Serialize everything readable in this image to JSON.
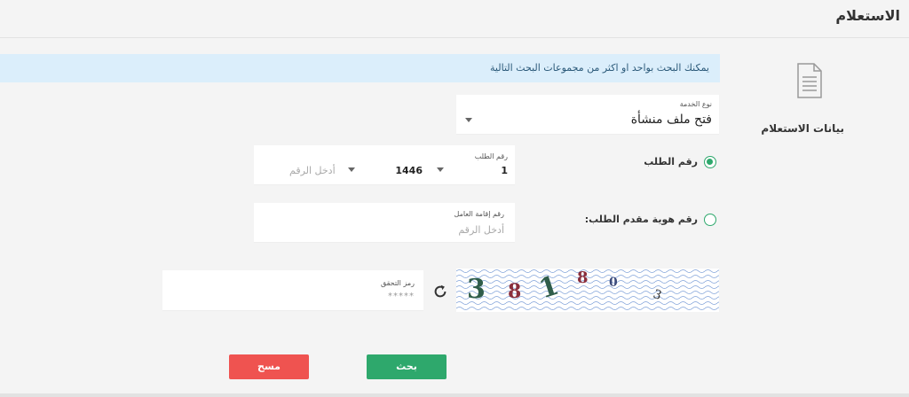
{
  "header": {
    "title": "الاستعلام"
  },
  "info": {
    "text": "يمكنك البحث بواحد او اكثر من مجموعات البحث التالية"
  },
  "sidebar": {
    "title": "بيانات الاستعلام",
    "icon": "document-icon"
  },
  "service": {
    "label": "نوع الخدمة",
    "value": "فتح ملف منشأة"
  },
  "search_by_request": {
    "label": "رقم الطلب",
    "selected": true,
    "field_label": "رقم الطلب",
    "number_value": "1",
    "year_value": "1446",
    "number_placeholder": "أدخل الرقم"
  },
  "search_by_id": {
    "label": "رقم هوية مقدم الطلب:",
    "selected": false,
    "field_label": "رقم إقامة العامل",
    "placeholder": "أدخل الرقم"
  },
  "captcha": {
    "field_label": "رمز التحقق",
    "placeholder": "*****",
    "chars": [
      "3",
      "8",
      "1",
      "8",
      "0",
      "3"
    ],
    "refresh_icon": "refresh-icon"
  },
  "buttons": {
    "search": "بحث",
    "clear": "مسح"
  },
  "colors": {
    "accent": "#2ea86c",
    "danger": "#ef5350",
    "info_bg": "#dbeefb"
  }
}
